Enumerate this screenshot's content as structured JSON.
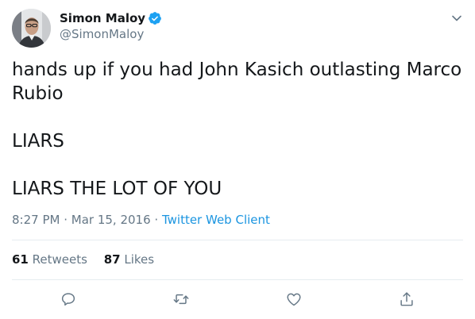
{
  "author": {
    "display_name": "Simon Maloy",
    "handle": "@SimonMaloy",
    "verified": true
  },
  "tweet": {
    "lines": [
      "hands up if you had John Kasich outlasting Marco Rubio",
      "LIARS",
      "LIARS THE LOT OF YOU"
    ]
  },
  "meta": {
    "time": "8:27 PM",
    "separator1": " · ",
    "date": "Mar 15, 2016",
    "separator2": " · ",
    "client": "Twitter Web Client"
  },
  "stats": {
    "retweets_count": "61",
    "retweets_label": "Retweets",
    "likes_count": "87",
    "likes_label": "Likes"
  },
  "actions": [
    "reply-icon",
    "retweet-icon",
    "like-icon",
    "share-icon"
  ],
  "colors": {
    "text": "#14171a",
    "secondary": "#657786",
    "accent": "#1b95e0",
    "divider": "#e6ecf0"
  }
}
